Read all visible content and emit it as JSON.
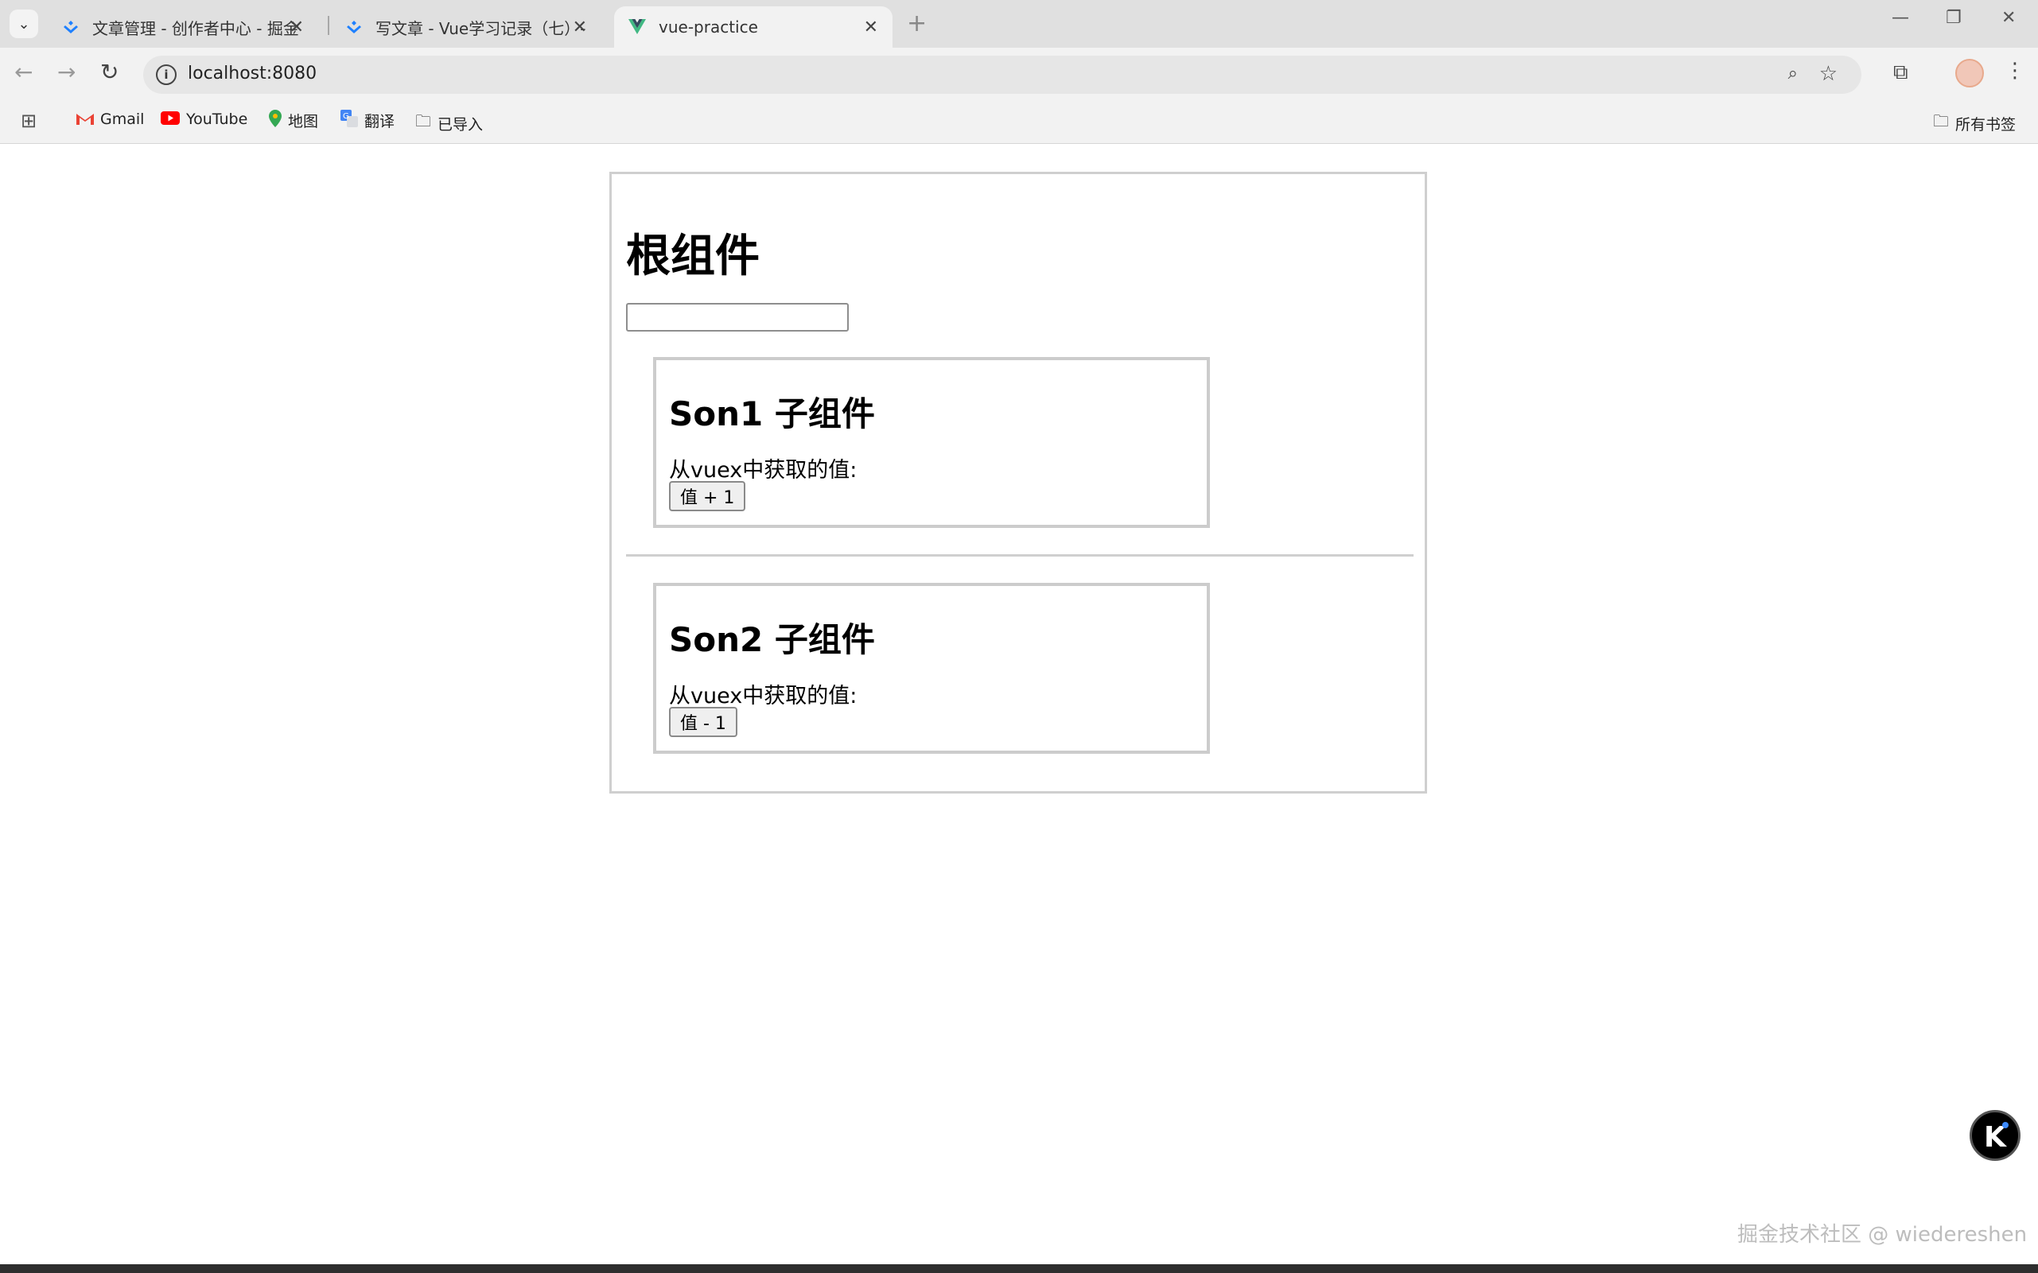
{
  "browser": {
    "tabs": [
      {
        "title": "文章管理 - 创作者中心 - 掘金",
        "active": false
      },
      {
        "title": "写文章 - Vue学习记录（七）-",
        "active": false
      },
      {
        "title": "vue-practice",
        "active": true
      }
    ],
    "url": "localhost:8080",
    "bookmarks": [
      {
        "label": "Gmail",
        "icon": "gmail-icon"
      },
      {
        "label": "YouTube",
        "icon": "youtube-icon"
      },
      {
        "label": "地图",
        "icon": "maps-icon"
      },
      {
        "label": "翻译",
        "icon": "translate-icon"
      },
      {
        "label": "已导入",
        "icon": "folder-icon"
      }
    ],
    "all_bookmarks_label": "所有书签"
  },
  "root": {
    "title": "根组件",
    "input_value": ""
  },
  "son1": {
    "title": "Son1 子组件",
    "text": "从vuex中获取的值:",
    "button_label": "值 + 1"
  },
  "son2": {
    "title": "Son2 子组件",
    "text": "从vuex中获取的值:",
    "button_label": "值 - 1"
  },
  "watermark": "掘金技术社区 @ wiedereshen",
  "colors": {
    "vue_green": "#41b883",
    "juejin_blue": "#1e80ff",
    "youtube_red": "#ff0000"
  }
}
